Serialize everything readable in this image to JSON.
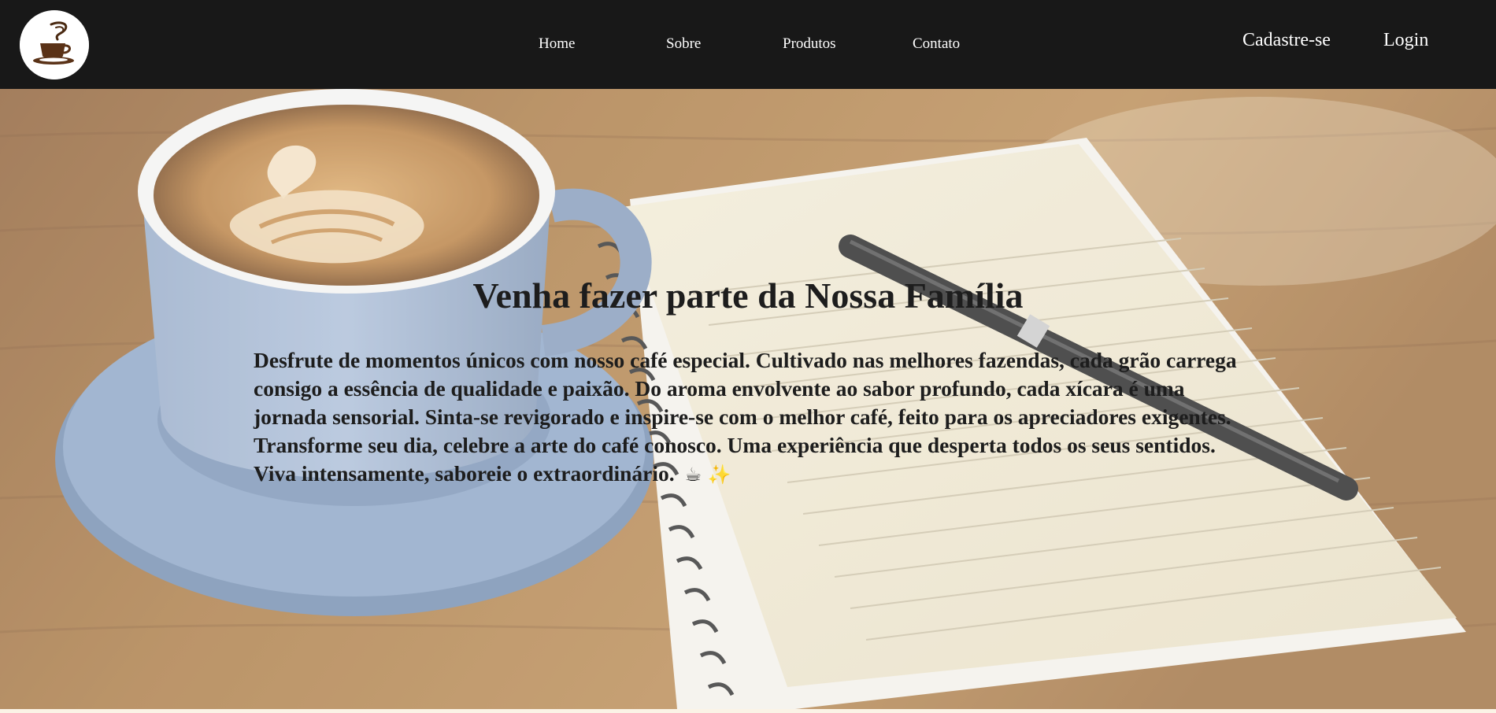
{
  "header": {
    "logo_name": "coffee-cup-logo",
    "nav": {
      "home": "Home",
      "sobre": "Sobre",
      "produtos": "Produtos",
      "contato": "Contato"
    },
    "auth": {
      "register": "Cadastre-se",
      "login": "Login"
    }
  },
  "hero": {
    "title": "Venha fazer parte da Nossa Família",
    "text": "Desfrute de momentos únicos com nosso café especial. Cultivado nas melhores fazendas, cada grão carrega consigo a essência de qualidade e paixão. Do aroma envolvente ao sabor profundo, cada xícara é uma jornada sensorial. Sinta-se revigorado e inspire-se com o melhor café, feito para os apreciadores exigentes. Transforme seu dia, celebre a arte do café conosco. Uma experiência que desperta todos os seus sentidos. Viva intensamente, saboreie o extraordinário.",
    "emoji": "☕ ✨",
    "background_image": "latte-cup-and-notebook-photo"
  },
  "colors": {
    "navbar": "#181818",
    "nav_text": "#ffffff",
    "hero_text": "#1d1d1d",
    "page_background": "#fbf3e6"
  }
}
